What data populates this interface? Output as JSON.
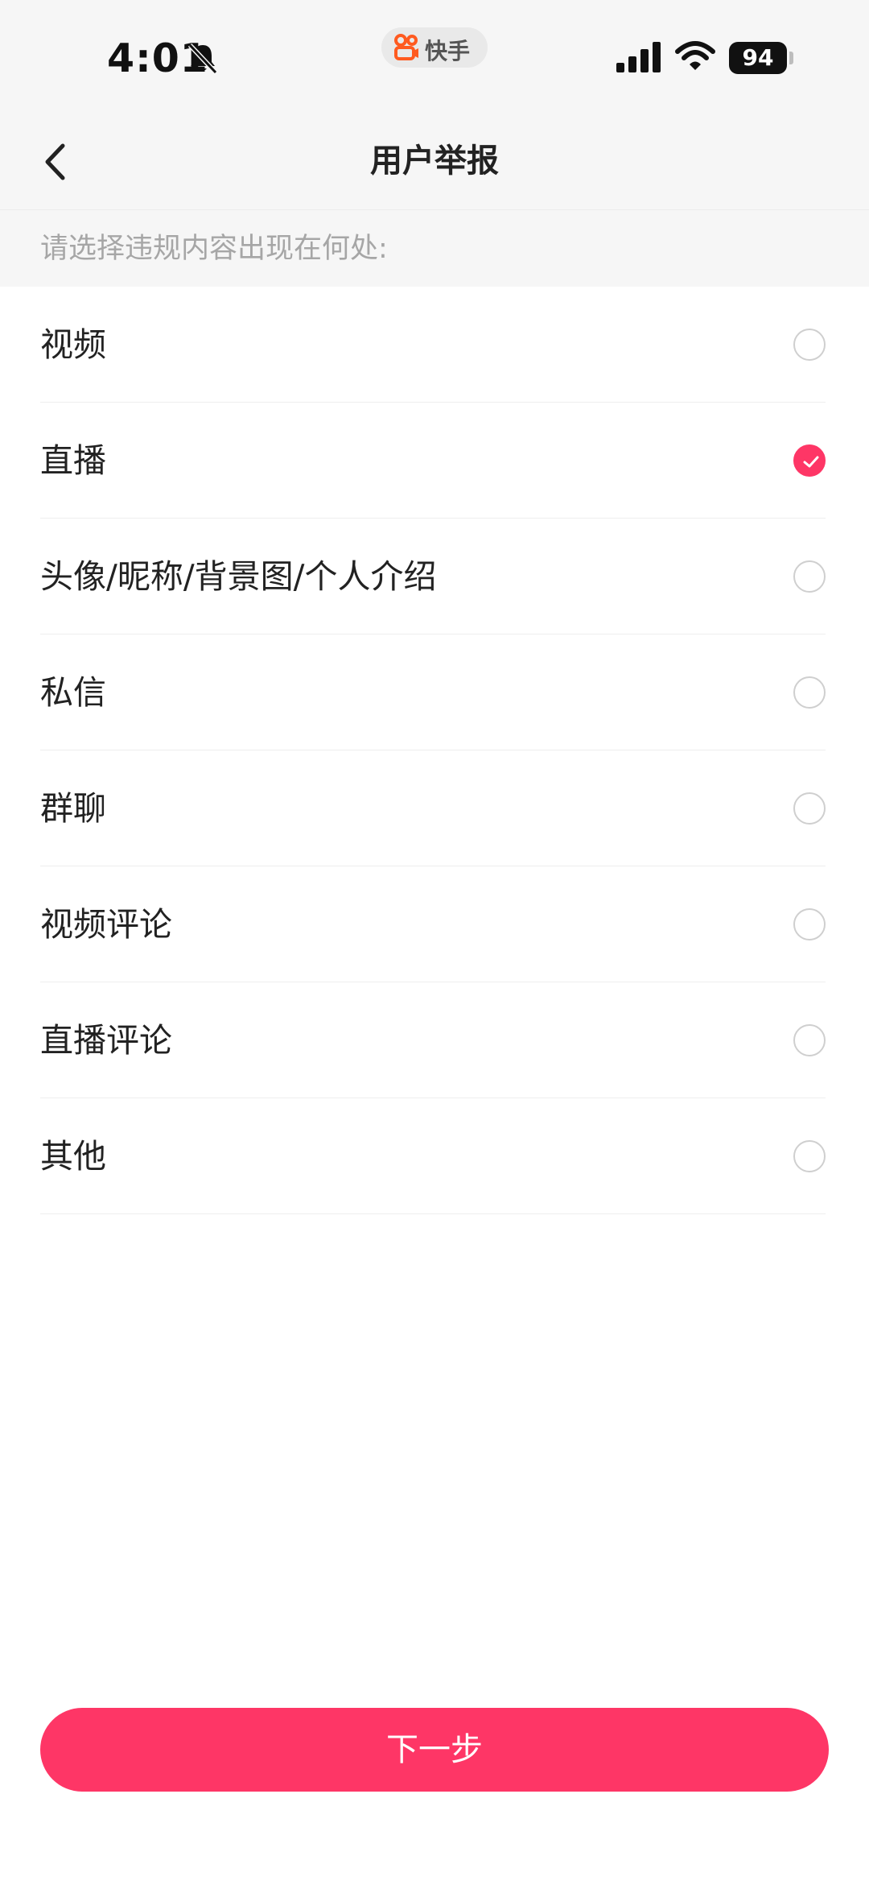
{
  "status_bar": {
    "time": "4:01",
    "app_badge": "快手",
    "battery": "94"
  },
  "header": {
    "title": "用户举报"
  },
  "prompt": "请选择违规内容出现在何处:",
  "options": [
    {
      "label": "视频",
      "selected": false
    },
    {
      "label": "直播",
      "selected": true
    },
    {
      "label": "头像/昵称/背景图/个人介绍",
      "selected": false
    },
    {
      "label": "私信",
      "selected": false
    },
    {
      "label": "群聊",
      "selected": false
    },
    {
      "label": "视频评论",
      "selected": false
    },
    {
      "label": "直播评论",
      "selected": false
    },
    {
      "label": "其他",
      "selected": false
    }
  ],
  "next_button": {
    "label": "下一步"
  },
  "colors": {
    "accent": "#fe3666",
    "brand": "#ff5a1f"
  }
}
